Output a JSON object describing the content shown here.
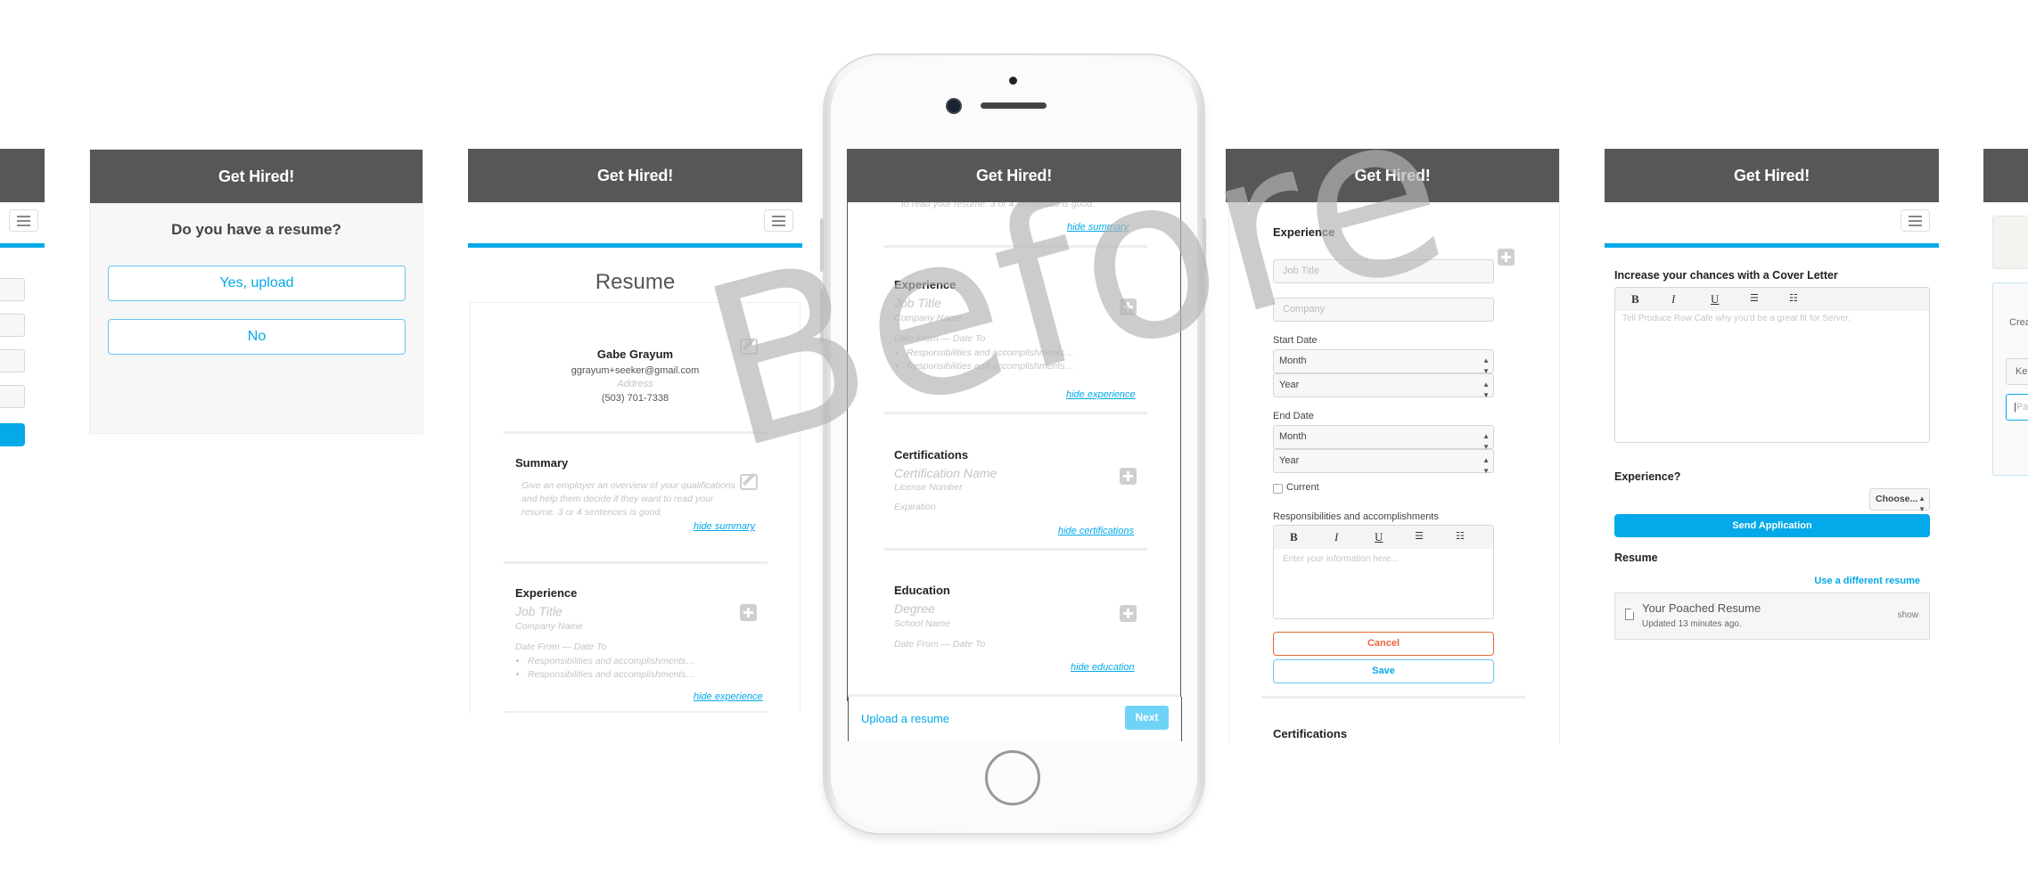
{
  "app_title": "Get Hired!",
  "watermark": "Before",
  "colors": {
    "accent": "#03a9e8",
    "header": "#575757",
    "cancel": "#e8663a",
    "next_disabled": "#6fd3f7"
  },
  "panel_resume_question": {
    "question": "Do you have a resume?",
    "yes_button": "Yes, upload",
    "no_button": "No"
  },
  "panel_resume": {
    "title": "Resume",
    "contact": {
      "name": "Gabe Grayum",
      "email": "ggrayum+seeker@gmail.com",
      "address_placeholder": "Address",
      "phone": "(503) 701-7338"
    },
    "summary": {
      "title": "Summary",
      "placeholder": "Give an employer an overview of your qualifications and help them decide if they want to read your resume. 3 or 4 sentences is good.",
      "hide_link": "hide summary"
    },
    "experience": {
      "title": "Experience",
      "job_title": "Job Title",
      "company": "Company Name",
      "dates": "Date From — Date To",
      "bullets": [
        "Responsibilities and accomplishments…",
        "Responsibilities and accomplishments…"
      ],
      "hide_link": "hide experience"
    }
  },
  "phone": {
    "summary_tail": "to read your resume. 3 or 4 sentences is good.",
    "hide_summary": "hide summary",
    "experience": {
      "title": "Experience",
      "job_title": "Job Title",
      "company": "Company Name",
      "dates": "Date From — Date To",
      "bullets": [
        "Responsibilities and accomplishments…",
        "Responsibilities and accomplishments…"
      ],
      "hide_link": "hide experience"
    },
    "certifications": {
      "title": "Certifications",
      "name": "Certification Name",
      "license": "License Number",
      "expiration": "Expiration",
      "hide_link": "hide certifications"
    },
    "education": {
      "title": "Education",
      "degree": "Degree",
      "school": "School Name",
      "dates": "Date From — Date To",
      "hide_link": "hide education"
    },
    "footer": {
      "upload_link": "Upload a resume",
      "next_button": "Next"
    }
  },
  "panel_experience_form": {
    "title": "Experience",
    "job_title_placeholder": "Job Title",
    "company_placeholder": "Company",
    "start_date_label": "Start Date",
    "end_date_label": "End Date",
    "month_option": "Month",
    "year_option": "Year",
    "current_label": "Current",
    "current_checked": false,
    "responsibilities_label": "Responsibilities and accomplishments",
    "toolbar": {
      "bold": "B",
      "italic": "I",
      "underline": "U"
    },
    "editor_placeholder": "Enter your information here...",
    "cancel_button": "Cancel",
    "save_button": "Save",
    "next_section": "Certifications"
  },
  "panel_cover_letter": {
    "cover_title": "Increase your chances with a Cover Letter",
    "toolbar": {
      "bold": "B",
      "italic": "I",
      "underline": "U"
    },
    "editor_placeholder": "Tell Produce Row Cafe why you'd be a great fit for Server.",
    "experience_label": "Experience?",
    "experience_select": "Choose...",
    "send_button": "Send Application",
    "resume_label": "Resume",
    "different_resume_link": "Use a different resume",
    "resume_card": {
      "name": "Your Poached Resume",
      "updated": "Updated 13 minutes ago.",
      "show_link": "show"
    }
  },
  "panel_partial_right": {
    "text_fragment": "Crea",
    "input1_fragment": "Ke",
    "input2_placeholder_fragment": "Pa"
  }
}
